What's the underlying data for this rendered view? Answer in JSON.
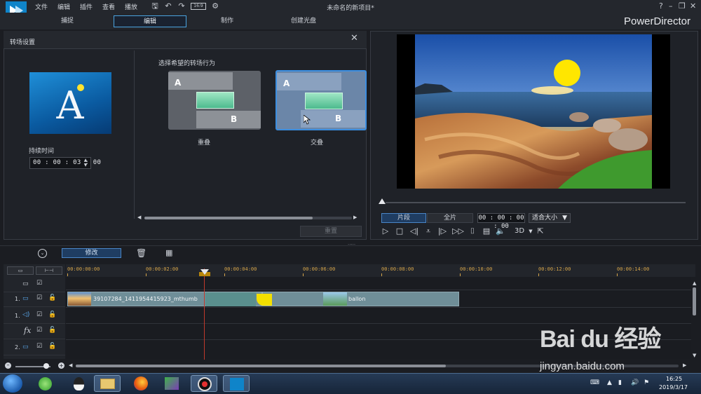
{
  "app": {
    "menu": [
      "文件",
      "编辑",
      "插件",
      "查看",
      "播放"
    ],
    "title": "未命名的新项目*",
    "brand": "PowerDirector",
    "toolbar_icons": [
      "save-icon",
      "undo-icon",
      "redo-icon",
      "aspect-ratio-icon",
      "settings-icon"
    ],
    "aspect_label": "16:9",
    "window_controls": [
      "?",
      "–",
      "❐",
      "✕"
    ]
  },
  "modes": {
    "tabs": [
      "捕捉",
      "编辑",
      "制作",
      "创建光盘"
    ],
    "active": "编辑"
  },
  "transition_panel": {
    "title": "转场设置",
    "thumbnail_letter": "A",
    "duration_label": "持续时间",
    "duration_value": "00 : 00 : 03 : 00",
    "choose_label": "选择希望的转场行为",
    "options": [
      {
        "label": "重叠",
        "a": "A",
        "b": "B",
        "selected": false
      },
      {
        "label": "交叠",
        "a": "A",
        "b": "B",
        "selected": true
      }
    ],
    "apply_label": "重置"
  },
  "preview": {
    "clip_tab": "片段",
    "full_tab": "全片",
    "timecode": "00 : 00 : 00 : 00",
    "fit_label": "适合大小",
    "mode_3d": "3D",
    "controls": [
      "play-icon",
      "stop-icon",
      "prev-frame-icon",
      "mark-icon",
      "next-frame-icon",
      "fast-forward-icon",
      "snapshot-icon",
      "subtitle-icon",
      "volume-icon",
      "3d-icon",
      "undock-icon"
    ]
  },
  "timeline": {
    "modify_label": "修改",
    "ruler_ticks": [
      "00:00:00:00",
      "00:00:02:00",
      "00:00:04:00",
      "00:00:06:00",
      "00:00:08:00",
      "00:00:10:00",
      "00:00:12:00",
      "00:00:14:00"
    ],
    "tracks": [
      {
        "num": "",
        "icon": "video-track-icon"
      },
      {
        "num": "1.",
        "icon": "video-track-icon"
      },
      {
        "num": "1.",
        "icon": "audio-track-icon"
      },
      {
        "num": "",
        "icon": "fx-track-icon",
        "label": "fx"
      },
      {
        "num": "2.",
        "icon": "video-track-icon"
      }
    ],
    "clips": [
      {
        "name": "39107284_1411954415923_mthumb"
      },
      {
        "name": "ballon"
      }
    ],
    "playhead_seconds": 3.5
  },
  "taskbar": {
    "time": "16:25",
    "date": "2019/3/17",
    "apps": [
      "browser-icon",
      "qq-icon",
      "explorer-icon",
      "firefox-icon",
      "media-icon",
      "record-icon",
      "powerdirector-icon"
    ]
  },
  "watermark": {
    "brand": "Bai du 经验",
    "url": "jingyan.baidu.com"
  }
}
